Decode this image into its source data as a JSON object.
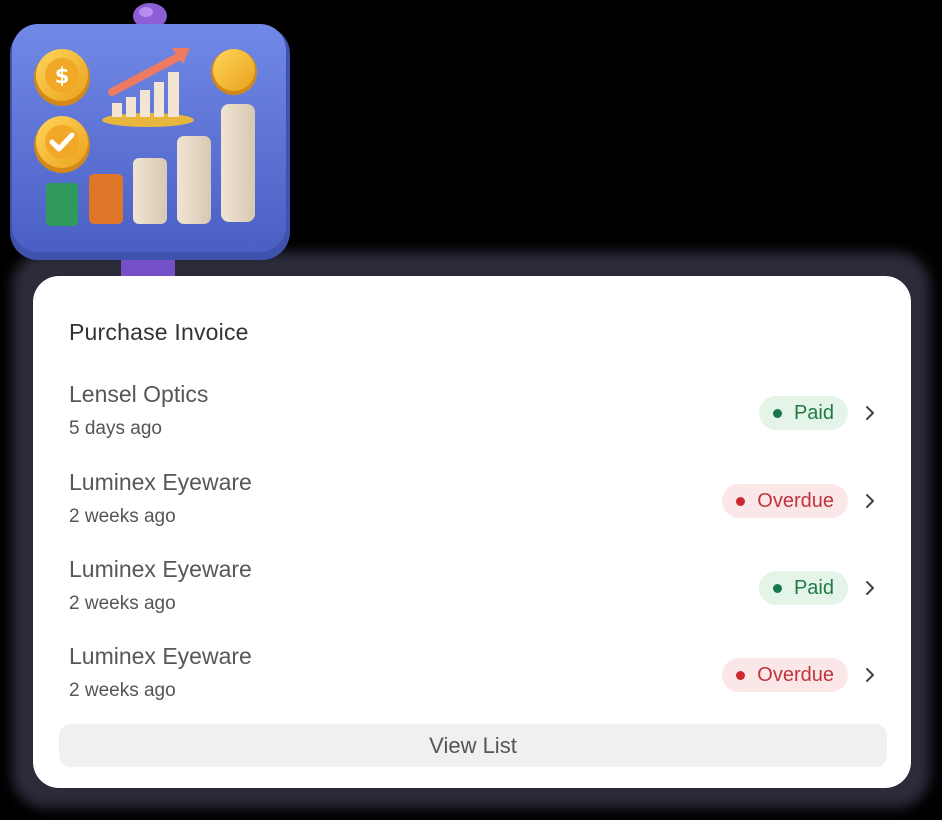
{
  "card": {
    "title": "Purchase Invoice",
    "view_list_label": "View List"
  },
  "invoices": [
    {
      "name": "Lensel Optics",
      "time": "5 days ago",
      "status": "Paid",
      "status_color": "#1f7a45"
    },
    {
      "name": "Luminex Eyeware",
      "time": "2 weeks ago",
      "status": "Overdue",
      "status_color": "#c0343c"
    },
    {
      "name": "Luminex Eyeware",
      "time": "2 weeks ago",
      "status": "Paid",
      "status_color": "#1f7a45"
    },
    {
      "name": "Luminex Eyeware",
      "time": "2 weeks ago",
      "status": "Overdue",
      "status_color": "#c0343c"
    }
  ],
  "icons": {
    "illustration": "presentation-board-chart-icon",
    "row_arrow": "chevron-right-icon",
    "status_dot": "dot-icon"
  },
  "colors": {
    "board": "#5b74d6",
    "paid_bg": "#e4f4e9",
    "overdue_bg": "#fbe7e8"
  }
}
